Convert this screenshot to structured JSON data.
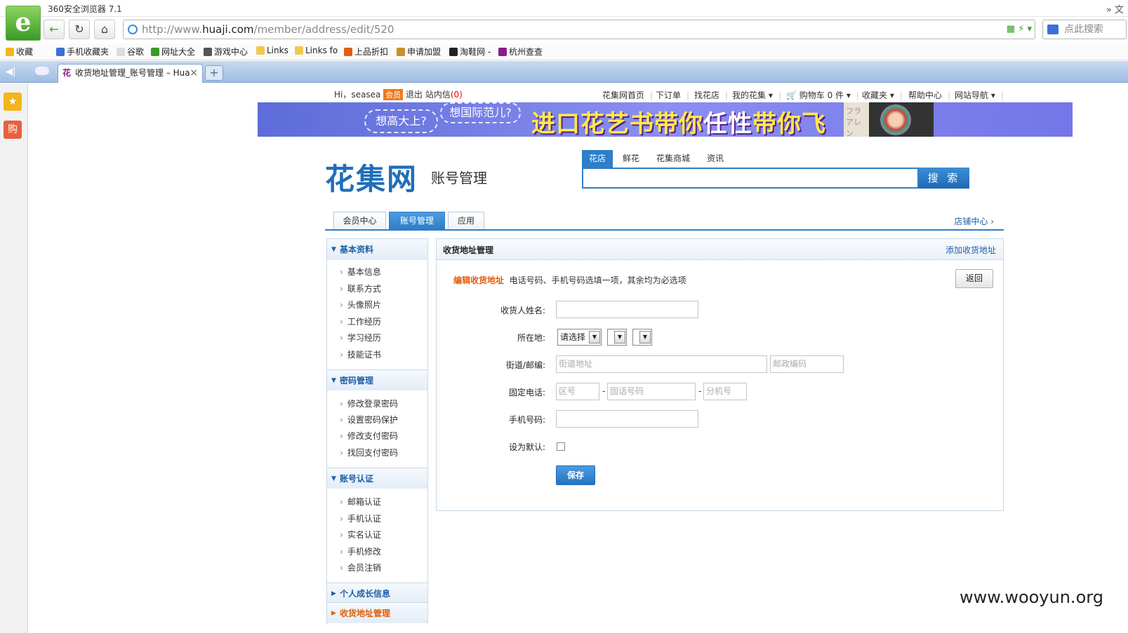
{
  "browser": {
    "title": "360安全浏览器 7.1",
    "title_right": "»  文",
    "url_prefix": "http://www.",
    "url_domain": "huaji.com",
    "url_path": "/member/address/edit/520",
    "search_placeholder": "点此搜索"
  },
  "bookmarks": [
    {
      "label": "收藏",
      "color": "#f2b51c"
    },
    {
      "label": "手机收藏夹",
      "color": "#3b6fd8"
    },
    {
      "label": "谷歌",
      "color": "#dddddd"
    },
    {
      "label": "网址大全",
      "color": "#3a9b27"
    },
    {
      "label": "游戏中心",
      "color": "#555555"
    },
    {
      "label": "Links",
      "color": "#f2c94c"
    },
    {
      "label": "Links fo",
      "color": "#f2c94c"
    },
    {
      "label": "上品折扣",
      "color": "#e25d0b"
    },
    {
      "label": "申请加盟",
      "color": "#c8902a"
    },
    {
      "label": "淘鞋网 -",
      "color": "#222222"
    },
    {
      "label": "杭州查查",
      "color": "#8a1b8a"
    }
  ],
  "tab": {
    "favicon": "花",
    "label": "收货地址管理_账号管理 – Hua",
    "close": "×",
    "new": "+"
  },
  "sidebar_icons": [
    {
      "name": "star-icon",
      "glyph": "★",
      "color": "#f2b51c"
    },
    {
      "name": "shop-icon",
      "glyph": "购",
      "color": "#e8603c"
    }
  ],
  "topnav": {
    "greeting": "Hi，",
    "user": "seasea",
    "vip": "会员",
    "logout": "退出",
    "messages": "站内信",
    "msg_count": "(0)",
    "links": [
      "花集网首页",
      "下订单",
      "找花店",
      "我的花集 ▾",
      "🛒 购物车 0 件 ▾",
      "收藏夹 ▾",
      "帮助中心",
      "网站导航 ▾"
    ]
  },
  "banner": {
    "bubble1": "想高大上?",
    "bubble2": "想国际范儿?",
    "main_a": "进口花艺书带你",
    "main_em": "任性",
    "main_b": "带你飞",
    "book_text": "フラ アレン"
  },
  "site": {
    "logo": "花集网",
    "subtitle": "账号管理",
    "search_tabs": [
      "花店",
      "鲜花",
      "花集商城",
      "资讯"
    ],
    "search_button": "搜 索"
  },
  "main_tabs": [
    "会员中心",
    "账号管理",
    "应用"
  ],
  "shop_center": "店铺中心 ›",
  "left_menu": [
    {
      "title": "基本资料",
      "items": [
        "基本信息",
        "联系方式",
        "头像照片",
        "工作经历",
        "学习经历",
        "技能证书"
      ]
    },
    {
      "title": "密码管理",
      "items": [
        "修改登录密码",
        "设置密码保护",
        "修改支付密码",
        "找回支付密码"
      ]
    },
    {
      "title": "账号认证",
      "items": [
        "邮箱认证",
        "手机认证",
        "实名认证",
        "手机修改",
        "会员注销"
      ]
    },
    {
      "title": "个人成长信息",
      "items": []
    },
    {
      "title": "收货地址管理",
      "items": []
    }
  ],
  "panel": {
    "title": "收货地址管理",
    "add_link": "添加收货地址",
    "form_title": "编辑收货地址",
    "form_note": "电话号码、手机号码选填一项，其余均为必选项",
    "back": "返回",
    "labels": {
      "name": "收货人姓名:",
      "location": "所在地:",
      "street": "街道/邮编:",
      "phone": "固定电话:",
      "mobile": "手机号码:",
      "default": "设为默认:"
    },
    "select_province": "请选择",
    "placeholders": {
      "street": "街道地址",
      "zip": "邮政编码",
      "area": "区号",
      "phone": "固话号码",
      "ext": "分机号"
    },
    "save": "保存"
  },
  "watermark": "www.wooyun.org"
}
